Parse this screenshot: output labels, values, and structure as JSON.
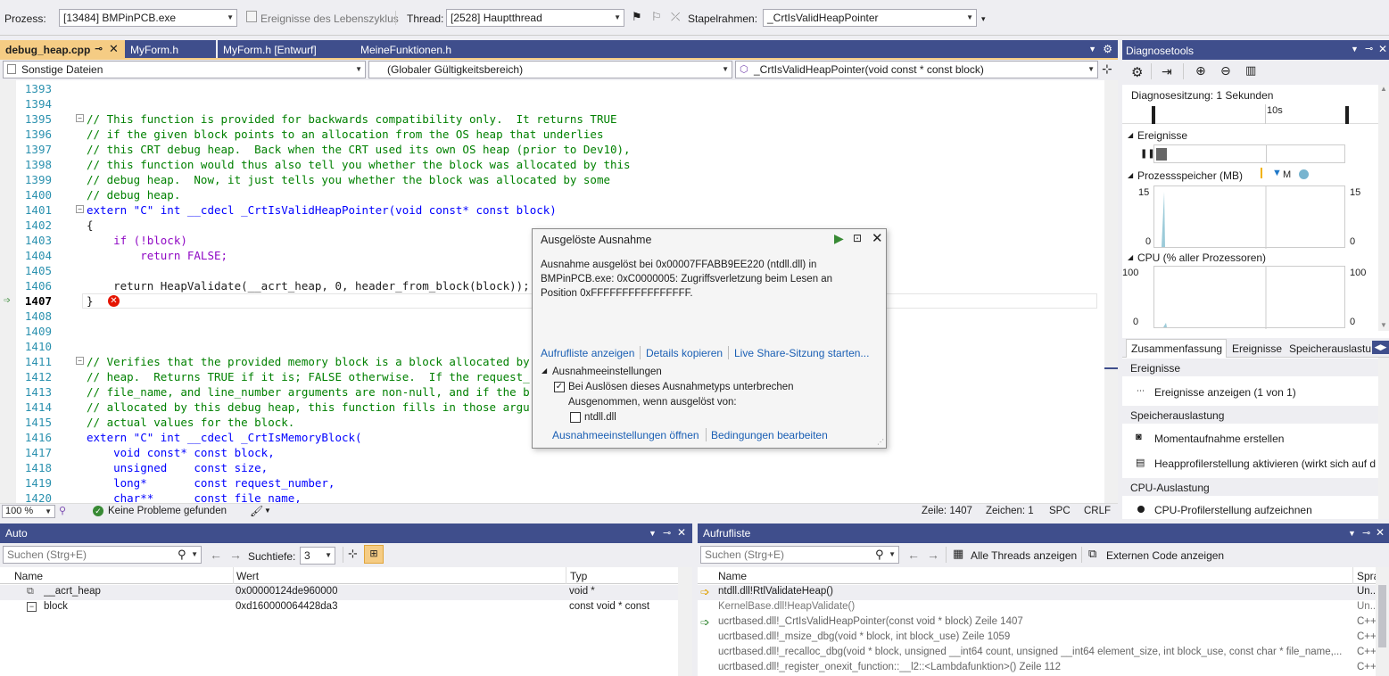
{
  "toolbar": {
    "process_label": "Prozess:",
    "process_value": "[13484] BMPinPCB.exe",
    "lifecycle_label": "Ereignisse des Lebenszyklus",
    "thread_label": "Thread:",
    "thread_value": "[2528] Hauptthread",
    "stackframe_label": "Stapelrahmen:",
    "stackframe_value": "_CrtIsValidHeapPointer"
  },
  "tabs": [
    {
      "label": "debug_heap.cpp",
      "active": true
    },
    {
      "label": "MyForm.h",
      "active": false
    },
    {
      "label": "MyForm.h [Entwurf]",
      "active": false
    },
    {
      "label": "MeineFunktionen.h",
      "active": false
    }
  ],
  "navbar": {
    "files": "Sonstige Dateien",
    "scope": "(Globaler Gültigkeitsbereich)",
    "member": "_CrtIsValidHeapPointer(void const * const block)"
  },
  "code_lines": [
    {
      "n": "1393",
      "t": ""
    },
    {
      "n": "1394",
      "t": ""
    },
    {
      "n": "1395",
      "t": "// This function is provided for backwards compatibility only.  It returns TRUE"
    },
    {
      "n": "1396",
      "t": "// if the given block points to an allocation from the OS heap that underlies"
    },
    {
      "n": "1397",
      "t": "// this CRT debug heap.  Back when the CRT used its own OS heap (prior to Dev10),"
    },
    {
      "n": "1398",
      "t": "// this function would thus also tell you whether the block was allocated by this"
    },
    {
      "n": "1399",
      "t": "// debug heap.  Now, it just tells you whether the block was allocated by some"
    },
    {
      "n": "1400",
      "t": "// debug heap."
    },
    {
      "n": "1401",
      "t": "extern \"C\" int __cdecl _CrtIsValidHeapPointer(void const* const block)"
    },
    {
      "n": "1402",
      "t": "{"
    },
    {
      "n": "1403",
      "t": "    if (!block)"
    },
    {
      "n": "1404",
      "t": "        return FALSE;"
    },
    {
      "n": "1405",
      "t": ""
    },
    {
      "n": "1406",
      "t": "    return HeapValidate(__acrt_heap, 0, header_from_block(block));"
    },
    {
      "n": "1407",
      "t": "}"
    },
    {
      "n": "1408",
      "t": ""
    },
    {
      "n": "1409",
      "t": ""
    },
    {
      "n": "1410",
      "t": ""
    },
    {
      "n": "1411",
      "t": "// Verifies that the provided memory block is a block allocated by"
    },
    {
      "n": "1412",
      "t": "// heap.  Returns TRUE if it is; FALSE otherwise.  If the request_"
    },
    {
      "n": "1413",
      "t": "// file_name, and line_number arguments are non-null, and if the b"
    },
    {
      "n": "1414",
      "t": "// allocated by this debug heap, this function fills in those argu"
    },
    {
      "n": "1415",
      "t": "// actual values for the block."
    },
    {
      "n": "1416",
      "t": "extern \"C\" int __cdecl _CrtIsMemoryBlock("
    },
    {
      "n": "1417",
      "t": "    void const* const block,"
    },
    {
      "n": "1418",
      "t": "    unsigned    const size,"
    },
    {
      "n": "1419",
      "t": "    long*       const request_number,"
    },
    {
      "n": "1420",
      "t": "    char**      const file_name,"
    }
  ],
  "editor_status": {
    "zoom": "100 %",
    "issues": "Keine Probleme gefunden",
    "line": "Zeile: 1407",
    "char": "Zeichen: 1",
    "spc": "SPC",
    "crlf": "CRLF"
  },
  "exception": {
    "title": "Ausgelöste Ausnahme",
    "message_1": "Ausnahme ausgelöst bei 0x00007FFABB9EE220 (ntdll.dll) in",
    "message_2": "BMPinPCB.exe: 0xC0000005: Zugriffsverletzung beim Lesen an",
    "message_3": "Position 0xFFFFFFFFFFFFFFFF.",
    "link_callstack": "Aufrufliste anzeigen",
    "link_copy": "Details kopieren",
    "link_liveshare": "Live Share-Sitzung starten...",
    "settings_header": "Ausnahmeeinstellungen",
    "break_label": "Bei Auslösen dieses Ausnahmetyps unterbrechen",
    "except_label": "Ausgenommen, wenn ausgelöst von:",
    "ntdll_label": "ntdll.dll",
    "link_open_settings": "Ausnahmeeinstellungen öffnen",
    "link_conditions": "Bedingungen bearbeiten"
  },
  "diag": {
    "title": "Diagnosetools",
    "session": "Diagnosesitzung: 1 Sekunden",
    "timeline_tick": "10s",
    "events_header": "Ereignisse",
    "memory_header": "Prozessspeicher (MB)",
    "memory_legend": "M",
    "memory_max": "15",
    "memory_min": "0",
    "cpu_header": "CPU (% aller Prozessoren)",
    "cpu_max": "100",
    "cpu_min": "0",
    "tabs": [
      "Zusammenfassung",
      "Ereignisse",
      "Speicherauslastung"
    ],
    "sec_events": "Ereignisse",
    "show_events": "Ereignisse anzeigen (1 von 1)",
    "sec_memory": "Speicherauslastung",
    "snapshot": "Momentaufnahme erstellen",
    "heap_profiling": "Heapprofilerstellung aktivieren (wirkt sich auf d",
    "sec_cpu": "CPU-Auslastung",
    "cpu_record": "CPU-Profilerstellung aufzeichnen"
  },
  "auto": {
    "title": "Auto",
    "search_placeholder": "Suchen (Strg+E)",
    "depth_label": "Suchtiefe:",
    "depth_value": "3",
    "columns": [
      "Name",
      "Wert",
      "Typ"
    ],
    "rows": [
      {
        "name": "__acrt_heap",
        "value": "0x00000124de960000",
        "type": "void *"
      },
      {
        "name": "block",
        "value": "0xd160000064428da3",
        "type": "const void * const"
      }
    ]
  },
  "callstack": {
    "title": "Aufrufliste",
    "search_placeholder": "Suchen (Strg+E)",
    "show_threads": "Alle Threads anzeigen",
    "show_external": "Externen Code anzeigen",
    "columns": [
      "Name",
      "Spra"
    ],
    "rows": [
      {
        "name": "ntdll.dll!RtlValidateHeap()",
        "lang": "Un..."
      },
      {
        "name": "KernelBase.dll!HeapValidate()",
        "lang": "Un..."
      },
      {
        "name": "ucrtbased.dll!_CrtIsValidHeapPointer(const void * block) Zeile 1407",
        "lang": "C++"
      },
      {
        "name": "ucrtbased.dll!_msize_dbg(void * block, int block_use) Zeile 1059",
        "lang": "C++"
      },
      {
        "name": "ucrtbased.dll!_recalloc_dbg(void * block, unsigned __int64 count, unsigned __int64 element_size, int block_use, const char * file_name,...",
        "lang": "C++"
      },
      {
        "name": "ucrtbased.dll!_register_onexit_function::__l2::<Lambdafunktion>() Zeile 112",
        "lang": "C++"
      }
    ]
  }
}
